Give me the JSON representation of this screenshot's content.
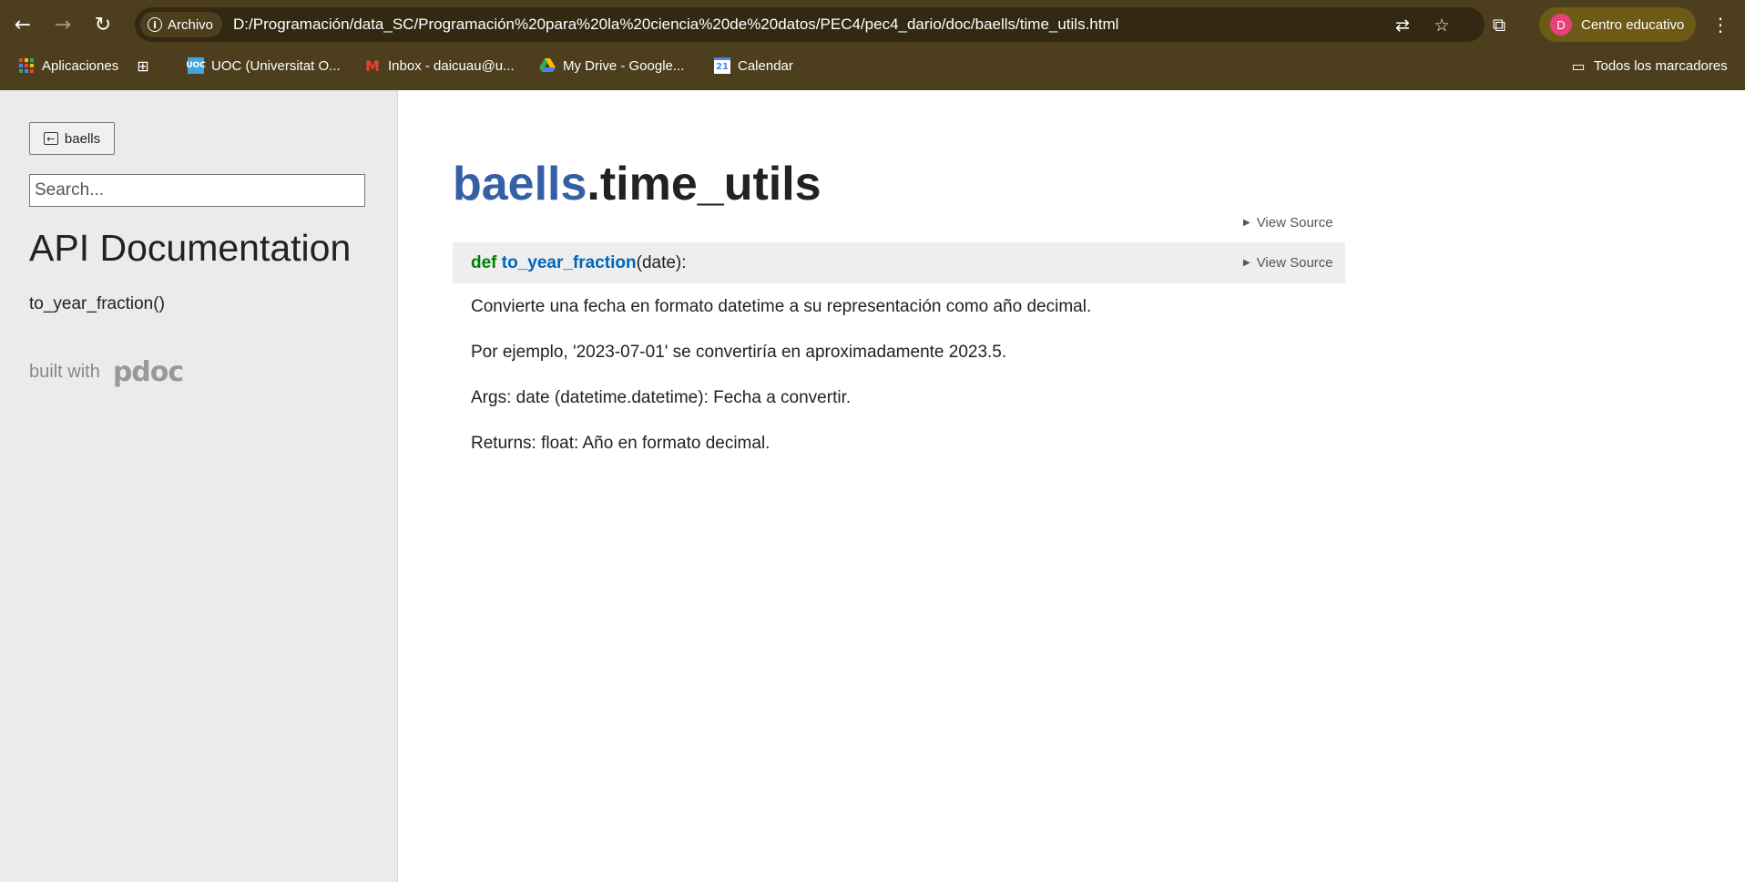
{
  "browser": {
    "chip_label": "Archivo",
    "url": "D:/Programación/data_SC/Programación%20para%20la%20ciencia%20de%20datos/PEC4/pec4_dario/doc/baells/time_utils.html",
    "profile_initial": "D",
    "profile_label": "Centro educativo",
    "bookmarks": [
      {
        "label": "Aplicaciones"
      },
      {
        "label": "UOC (Universitat O..."
      },
      {
        "label": "Inbox - daicuau@u..."
      },
      {
        "label": "My Drive - Google..."
      },
      {
        "label": "Calendar"
      }
    ],
    "all_bookmarks": "Todos los marcadores",
    "calendar_day": "21"
  },
  "sidebar": {
    "back_label": "baells",
    "search_placeholder": "Search...",
    "title": "API Documentation",
    "items": [
      {
        "label": "to_year_fraction()"
      }
    ],
    "built_with": "built with",
    "logo_text": "pdoc"
  },
  "main": {
    "module_pkg": "baells",
    "module_name": ".time_utils",
    "view_source": "View Source",
    "function": {
      "keyword": "def",
      "name": "to_year_fraction",
      "params": "(date):"
    },
    "docstring": [
      "Convierte una fecha en formato datetime a su representación como año decimal.",
      "Por ejemplo, '2023-07-01' se convertiría en aproximadamente 2023.5.",
      "Args: date (datetime.datetime): Fecha a convertir.",
      "Returns: float: Año en formato decimal."
    ]
  },
  "colors": {
    "chrome_bg": "#4d3f1e",
    "omnibox_bg": "#332812",
    "package_blue": "#3660a5",
    "keyword_green": "#008000",
    "function_blue": "#0066bb"
  }
}
